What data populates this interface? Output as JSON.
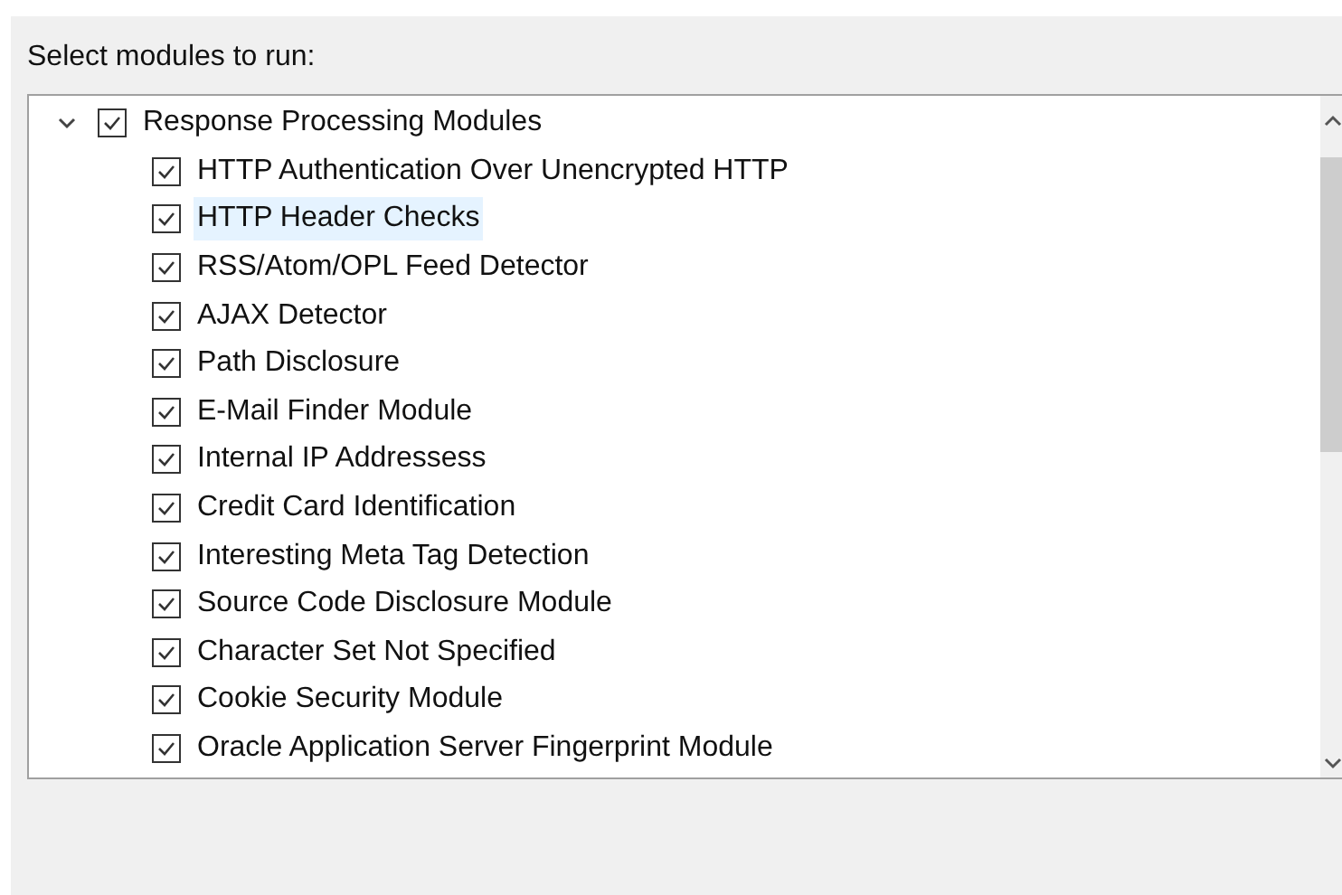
{
  "prompt": "Select modules to run:",
  "tree": [
    {
      "label": "Response Processing Modules",
      "checked": true,
      "expanded": true,
      "selected": false,
      "children": [
        {
          "label": "HTTP Authentication Over Unencrypted HTTP",
          "checked": true,
          "selected": false
        },
        {
          "label": "HTTP Header Checks",
          "checked": true,
          "selected": true
        },
        {
          "label": "RSS/Atom/OPL Feed Detector",
          "checked": true,
          "selected": false
        },
        {
          "label": "AJAX Detector",
          "checked": true,
          "selected": false
        },
        {
          "label": "Path Disclosure",
          "checked": true,
          "selected": false
        },
        {
          "label": "E-Mail Finder Module",
          "checked": true,
          "selected": false
        },
        {
          "label": "Internal IP Addressess",
          "checked": true,
          "selected": false
        },
        {
          "label": "Credit Card Identification",
          "checked": true,
          "selected": false
        },
        {
          "label": "Interesting Meta Tag Detection",
          "checked": true,
          "selected": false
        },
        {
          "label": "Source Code Disclosure Module",
          "checked": true,
          "selected": false
        },
        {
          "label": "Character Set Not Specified",
          "checked": true,
          "selected": false
        },
        {
          "label": "Cookie Security Module",
          "checked": true,
          "selected": false
        },
        {
          "label": "Oracle Application Server Fingerprint Module",
          "checked": true,
          "selected": false
        }
      ]
    }
  ]
}
